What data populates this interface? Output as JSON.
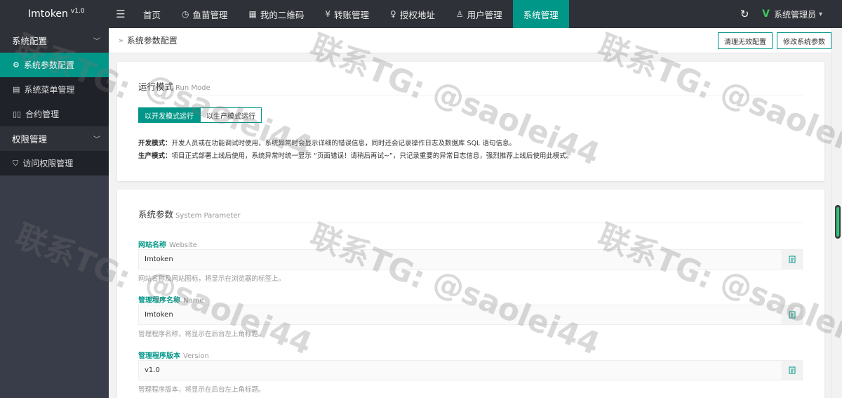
{
  "app": {
    "name": "Imtoken",
    "version": "v1.0"
  },
  "topnav": {
    "items": [
      {
        "label": "首页",
        "icon": ""
      },
      {
        "label": "鱼苗管理",
        "icon": "clock-icon"
      },
      {
        "label": "我的二维码",
        "icon": "qrcode-icon"
      },
      {
        "label": "转账管理",
        "icon": "yen-icon"
      },
      {
        "label": "授权地址",
        "icon": "bulb-icon"
      },
      {
        "label": "用户管理",
        "icon": "user-icon"
      },
      {
        "label": "系统管理",
        "icon": "",
        "active": true
      }
    ],
    "user": "系统管理员"
  },
  "sidebar": {
    "groups": [
      {
        "label": "系统配置",
        "items": [
          {
            "label": "系统参数配置",
            "icon": "gear-icon",
            "active": true
          },
          {
            "label": "系统菜单管理",
            "icon": "menu-icon"
          },
          {
            "label": "合约管理",
            "icon": "contract-icon"
          }
        ]
      },
      {
        "label": "权限管理",
        "items": [
          {
            "label": "访问权限管理",
            "icon": "shield-icon"
          }
        ]
      }
    ]
  },
  "breadcrumb": {
    "title": "系统参数配置"
  },
  "actions": {
    "clear": "清理无效配置",
    "edit": "修改系统参数"
  },
  "run_mode": {
    "title": "运行模式",
    "subtitle": "Run Mode",
    "dev_btn": "以开发模式运行",
    "prod_btn": "以生产模式运行",
    "dev_label": "开发模式：",
    "dev_desc": "开发人员或在功能调试时使用，系统异常时会显示详细的错误信息，同时还会记录操作日志及数据库 SQL 语句信息。",
    "prod_label": "生产模式：",
    "prod_desc": "项目正式部署上线后使用，系统异常时统一显示 “页面错误！请稍后再试~”，只记录重要的异常日志信息，强烈推荐上线后使用此模式。"
  },
  "system_params": {
    "title": "系统参数",
    "subtitle": "System Parameter",
    "fields": [
      {
        "label": "网站名称",
        "en": "Website",
        "value": "Imtoken",
        "help": "网站名称及网站图标，将显示在浏览器的标签上。"
      },
      {
        "label": "管理程序名称",
        "en": "Name",
        "value": "Imtoken",
        "help": "管理程序名称，将显示在后台左上角标题。"
      },
      {
        "label": "管理程序版本",
        "en": "Version",
        "value": "v1.0",
        "help": "管理程序版本，将显示在后台左上角标题。"
      }
    ]
  },
  "watermark": {
    "line1": "联系TG:",
    "line2": "@saolei44"
  },
  "colors": {
    "accent": "#009688",
    "topbar": "#2e3137",
    "sidebar": "#393d49"
  }
}
